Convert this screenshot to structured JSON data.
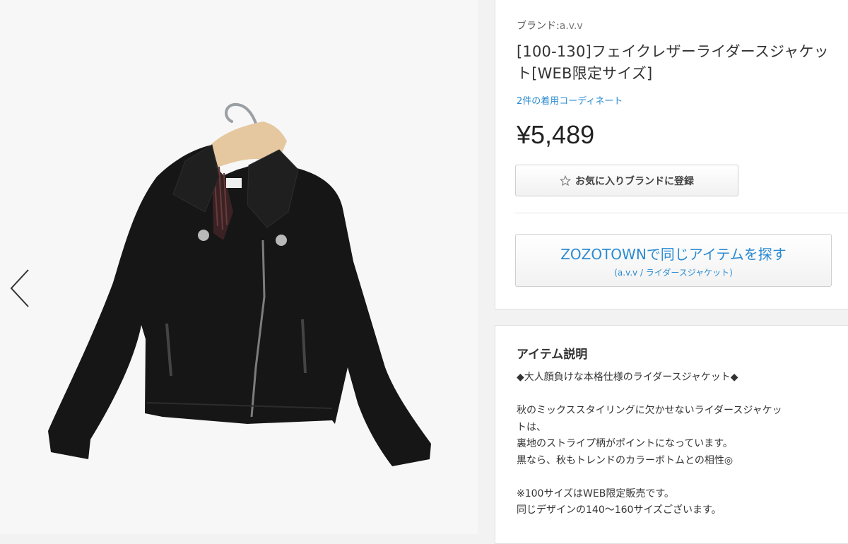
{
  "product": {
    "brand_prefix": "ブランド:",
    "brand_name": "a.v.v",
    "title": "[100-130]フェイクレザーライダースジャケット[WEB限定サイズ]",
    "coordinate_link": "2件の着用コーディネート",
    "price": "¥5,489",
    "favorite_brand_button": "お気に入りブランドに登録",
    "zozotown_button": "ZOZOTOWNで同じアイテムを探す",
    "zozotown_sub": "(a.v.v / ライダースジャケット)"
  },
  "description": {
    "heading": "アイテム説明",
    "lines": [
      "◆大人顔負けな本格仕様のライダースジャケット◆",
      "",
      "秋のミックススタイリングに欠かせないライダースジャケットは、",
      "裏地のストライプ柄がポイントになっています。",
      "黒なら、秋もトレンドのカラーボトムとの相性◎",
      "",
      "※100サイズはWEB限定販売です。",
      "同じデザインの140〜160サイズございます。"
    ]
  },
  "icons": {
    "prev": "chevron-left-icon",
    "star": "star-outline-icon"
  },
  "colors": {
    "link_blue": "#2a8ad2",
    "jacket": "#161616"
  }
}
